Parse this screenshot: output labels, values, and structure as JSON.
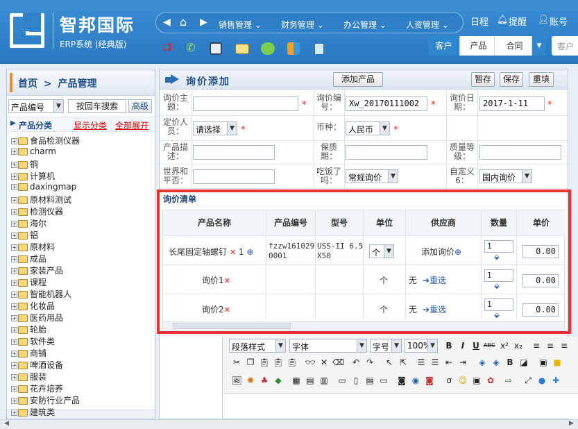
{
  "header": {
    "brand": "智邦国际",
    "brand_sub": "ERP系统 (经典版)",
    "nav": [
      "销售管理",
      "财务管理",
      "办公管理",
      "人资管理"
    ],
    "right": {
      "calendar": "日程",
      "remind": "提醒",
      "account": "账号"
    },
    "segments": [
      "客户",
      "产品",
      "合同"
    ],
    "search_placeholder": "客户"
  },
  "sidebar": {
    "breadcrumb_home": "首页",
    "breadcrumb_sep": ">",
    "breadcrumb_page": "产品管理",
    "filter_select": "产品编号",
    "search_button": "按回车搜索",
    "advanced_button": "高级",
    "category_title": "产品分类",
    "show_link": "显示分类",
    "expand_link": "全部展开",
    "tree": [
      "食品检测仪器",
      "charm",
      "铜",
      "计算机",
      "daxingmap",
      "原材料测试",
      "检测仪器",
      "海尔",
      "铝",
      "原材料",
      "成品",
      "家装产品",
      "课程",
      "智能机器人",
      "化妆品",
      "医药用品",
      "轮胎",
      "软件类",
      "商铺",
      "啤酒设备",
      "服装",
      "花卉培养",
      "安防行业产品",
      "建筑类"
    ]
  },
  "form": {
    "title": "询价添加",
    "add_product": "添加产品",
    "save_draft": "暂存",
    "save": "保存",
    "refill": "重填",
    "subject_label": "询价主题：",
    "number_label": "询价编号：",
    "number_value": "Xw_20170111002",
    "date_label": "询价日期：",
    "date_value": "2017-1-11",
    "person_label": "定价人员：",
    "person_value": "请选择",
    "currency_label": "币种：",
    "currency_value": "人民币",
    "desc_label": "产品描述：",
    "warranty_label": "保质期：",
    "quality_label": "质量等级：",
    "peace_label": "世界和平否：",
    "eat_label": "吃饭了吗：",
    "eat_value": "常规询价",
    "custom6_label": "自定义6：",
    "custom6_value": "国内询价"
  },
  "inquiry_list": {
    "title": "询价清单",
    "columns": [
      "产品名称",
      "产品编号",
      "型号",
      "单位",
      "供应商",
      "数量",
      "单价"
    ],
    "rows": [
      {
        "name": "长尾固定轴螺钉",
        "count": "1",
        "code": "fzzw1610290001",
        "code_a": "fzzw161029",
        "code_b": "0001",
        "model_a": "USS-II 6.5",
        "model_b": "X50",
        "unit": "个",
        "supplier": "添加询价",
        "qty": "1",
        "price": "0.00"
      },
      {
        "name": "询价1",
        "code": "",
        "model_a": "",
        "model_b": "",
        "unit": "个",
        "supplier_none": "无",
        "supplier": "重选",
        "qty": "1",
        "price": "0.00"
      },
      {
        "name": "询价2",
        "code": "",
        "model_a": "",
        "model_b": "",
        "unit": "个",
        "supplier_none": "无",
        "supplier": "重选",
        "qty": "1",
        "price": "0.00"
      }
    ]
  },
  "editor": {
    "para_style": "段落样式",
    "font": "字体",
    "size": "字号",
    "zoom": "100%"
  }
}
